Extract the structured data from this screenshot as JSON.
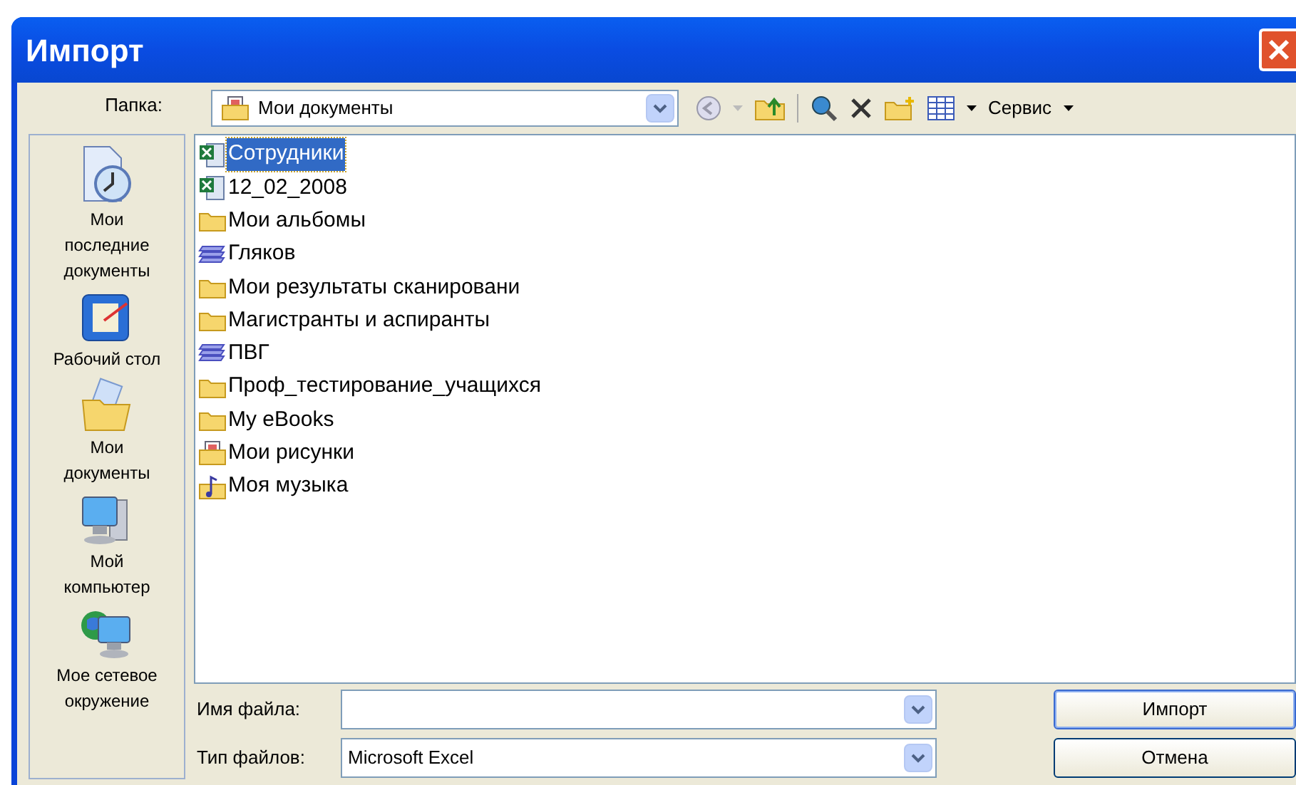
{
  "window": {
    "title": "Импорт"
  },
  "toolbar": {
    "folder_label": "Папка:",
    "folder_value": "Мои документы",
    "tools_menu": "Сервис"
  },
  "places": [
    {
      "kind": "recent",
      "label": "Мои последние документы"
    },
    {
      "kind": "desktop",
      "label": "Рабочий стол"
    },
    {
      "kind": "documents",
      "label": "Мои документы"
    },
    {
      "kind": "computer",
      "label": "Мой компьютер"
    },
    {
      "kind": "network",
      "label": "Мое сетевое окружение"
    }
  ],
  "files": [
    {
      "kind": "excel",
      "name": "Сотрудники",
      "selected": true
    },
    {
      "kind": "excel",
      "name": "12_02_2008",
      "selected": false
    },
    {
      "kind": "folder",
      "name": "Мои альбомы",
      "selected": false
    },
    {
      "kind": "stack",
      "name": "Гляков",
      "selected": false
    },
    {
      "kind": "folder",
      "name": "Мои результаты сканировани",
      "selected": false
    },
    {
      "kind": "folder",
      "name": "Магистранты и аспиранты",
      "selected": false
    },
    {
      "kind": "stack",
      "name": "ПВГ",
      "selected": false
    },
    {
      "kind": "folder",
      "name": "Проф_тестирование_учащихся",
      "selected": false
    },
    {
      "kind": "folder",
      "name": "My eBooks",
      "selected": false
    },
    {
      "kind": "pictures",
      "name": "Мои рисунки",
      "selected": false
    },
    {
      "kind": "music",
      "name": "Моя музыка",
      "selected": false
    }
  ],
  "file_name": {
    "label": "Имя файла:"
  },
  "file_type": {
    "label": "Тип файлов:",
    "value": "Microsoft Excel"
  },
  "buttons": [
    {
      "kind": "primary",
      "label": "Импорт"
    },
    {
      "kind": "normal",
      "label": "Отмена"
    }
  ]
}
